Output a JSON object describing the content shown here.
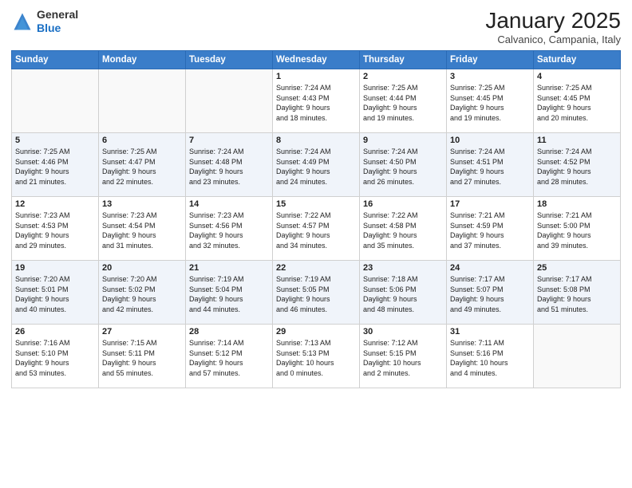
{
  "logo": {
    "line1": "General",
    "line2": "Blue"
  },
  "title": "January 2025",
  "subtitle": "Calvanico, Campania, Italy",
  "headers": [
    "Sunday",
    "Monday",
    "Tuesday",
    "Wednesday",
    "Thursday",
    "Friday",
    "Saturday"
  ],
  "weeks": [
    [
      {
        "day": "",
        "info": ""
      },
      {
        "day": "",
        "info": ""
      },
      {
        "day": "",
        "info": ""
      },
      {
        "day": "1",
        "info": "Sunrise: 7:24 AM\nSunset: 4:43 PM\nDaylight: 9 hours\nand 18 minutes."
      },
      {
        "day": "2",
        "info": "Sunrise: 7:25 AM\nSunset: 4:44 PM\nDaylight: 9 hours\nand 19 minutes."
      },
      {
        "day": "3",
        "info": "Sunrise: 7:25 AM\nSunset: 4:45 PM\nDaylight: 9 hours\nand 19 minutes."
      },
      {
        "day": "4",
        "info": "Sunrise: 7:25 AM\nSunset: 4:45 PM\nDaylight: 9 hours\nand 20 minutes."
      }
    ],
    [
      {
        "day": "5",
        "info": "Sunrise: 7:25 AM\nSunset: 4:46 PM\nDaylight: 9 hours\nand 21 minutes."
      },
      {
        "day": "6",
        "info": "Sunrise: 7:25 AM\nSunset: 4:47 PM\nDaylight: 9 hours\nand 22 minutes."
      },
      {
        "day": "7",
        "info": "Sunrise: 7:24 AM\nSunset: 4:48 PM\nDaylight: 9 hours\nand 23 minutes."
      },
      {
        "day": "8",
        "info": "Sunrise: 7:24 AM\nSunset: 4:49 PM\nDaylight: 9 hours\nand 24 minutes."
      },
      {
        "day": "9",
        "info": "Sunrise: 7:24 AM\nSunset: 4:50 PM\nDaylight: 9 hours\nand 26 minutes."
      },
      {
        "day": "10",
        "info": "Sunrise: 7:24 AM\nSunset: 4:51 PM\nDaylight: 9 hours\nand 27 minutes."
      },
      {
        "day": "11",
        "info": "Sunrise: 7:24 AM\nSunset: 4:52 PM\nDaylight: 9 hours\nand 28 minutes."
      }
    ],
    [
      {
        "day": "12",
        "info": "Sunrise: 7:23 AM\nSunset: 4:53 PM\nDaylight: 9 hours\nand 29 minutes."
      },
      {
        "day": "13",
        "info": "Sunrise: 7:23 AM\nSunset: 4:54 PM\nDaylight: 9 hours\nand 31 minutes."
      },
      {
        "day": "14",
        "info": "Sunrise: 7:23 AM\nSunset: 4:56 PM\nDaylight: 9 hours\nand 32 minutes."
      },
      {
        "day": "15",
        "info": "Sunrise: 7:22 AM\nSunset: 4:57 PM\nDaylight: 9 hours\nand 34 minutes."
      },
      {
        "day": "16",
        "info": "Sunrise: 7:22 AM\nSunset: 4:58 PM\nDaylight: 9 hours\nand 35 minutes."
      },
      {
        "day": "17",
        "info": "Sunrise: 7:21 AM\nSunset: 4:59 PM\nDaylight: 9 hours\nand 37 minutes."
      },
      {
        "day": "18",
        "info": "Sunrise: 7:21 AM\nSunset: 5:00 PM\nDaylight: 9 hours\nand 39 minutes."
      }
    ],
    [
      {
        "day": "19",
        "info": "Sunrise: 7:20 AM\nSunset: 5:01 PM\nDaylight: 9 hours\nand 40 minutes."
      },
      {
        "day": "20",
        "info": "Sunrise: 7:20 AM\nSunset: 5:02 PM\nDaylight: 9 hours\nand 42 minutes."
      },
      {
        "day": "21",
        "info": "Sunrise: 7:19 AM\nSunset: 5:04 PM\nDaylight: 9 hours\nand 44 minutes."
      },
      {
        "day": "22",
        "info": "Sunrise: 7:19 AM\nSunset: 5:05 PM\nDaylight: 9 hours\nand 46 minutes."
      },
      {
        "day": "23",
        "info": "Sunrise: 7:18 AM\nSunset: 5:06 PM\nDaylight: 9 hours\nand 48 minutes."
      },
      {
        "day": "24",
        "info": "Sunrise: 7:17 AM\nSunset: 5:07 PM\nDaylight: 9 hours\nand 49 minutes."
      },
      {
        "day": "25",
        "info": "Sunrise: 7:17 AM\nSunset: 5:08 PM\nDaylight: 9 hours\nand 51 minutes."
      }
    ],
    [
      {
        "day": "26",
        "info": "Sunrise: 7:16 AM\nSunset: 5:10 PM\nDaylight: 9 hours\nand 53 minutes."
      },
      {
        "day": "27",
        "info": "Sunrise: 7:15 AM\nSunset: 5:11 PM\nDaylight: 9 hours\nand 55 minutes."
      },
      {
        "day": "28",
        "info": "Sunrise: 7:14 AM\nSunset: 5:12 PM\nDaylight: 9 hours\nand 57 minutes."
      },
      {
        "day": "29",
        "info": "Sunrise: 7:13 AM\nSunset: 5:13 PM\nDaylight: 10 hours\nand 0 minutes."
      },
      {
        "day": "30",
        "info": "Sunrise: 7:12 AM\nSunset: 5:15 PM\nDaylight: 10 hours\nand 2 minutes."
      },
      {
        "day": "31",
        "info": "Sunrise: 7:11 AM\nSunset: 5:16 PM\nDaylight: 10 hours\nand 4 minutes."
      },
      {
        "day": "",
        "info": ""
      }
    ]
  ]
}
